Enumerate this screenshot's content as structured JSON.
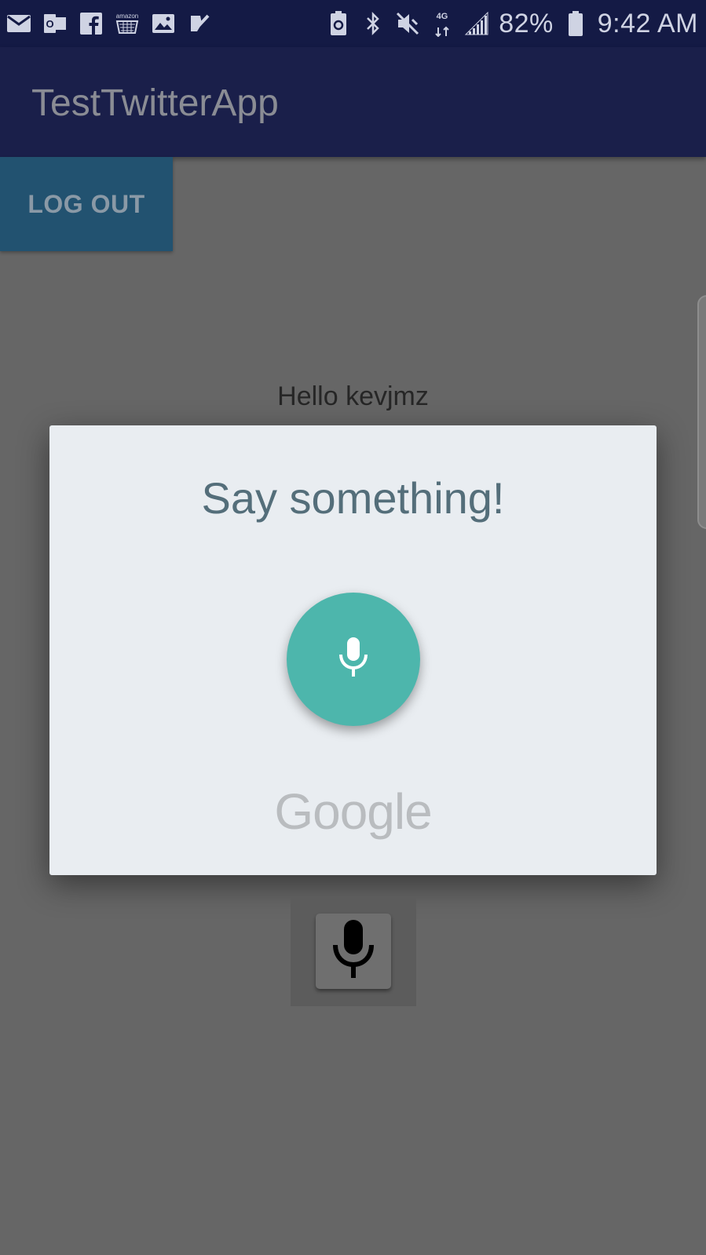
{
  "status_bar": {
    "left_icons": [
      "mail-icon",
      "outlook-icon",
      "facebook-icon",
      "amazon-icon",
      "gallery-icon",
      "tasks-icon"
    ],
    "amazon_label": "amazon",
    "right_icons": [
      "battery-saver-icon",
      "bluetooth-icon",
      "mute-icon",
      "4g-lte-icon",
      "signal-icon"
    ],
    "network_label": "4G",
    "battery": "82%",
    "time": "9:42 AM"
  },
  "app_bar": {
    "title": "TestTwitterApp"
  },
  "logout_button": {
    "label": "LOG OUT"
  },
  "greeting": "Hello kevjmz",
  "dialog": {
    "title": "Say something!",
    "mic_icon": "mic-icon",
    "brand": "Google"
  },
  "speech_button": {
    "icon": "mic-icon"
  },
  "colors": {
    "status_bar": "#141a45",
    "app_bar": "#1a1f4a",
    "logout_button": "#225270",
    "dialog_bg": "#e9edf1",
    "mic_accent": "#4db6ac",
    "scrim": "#666666"
  }
}
